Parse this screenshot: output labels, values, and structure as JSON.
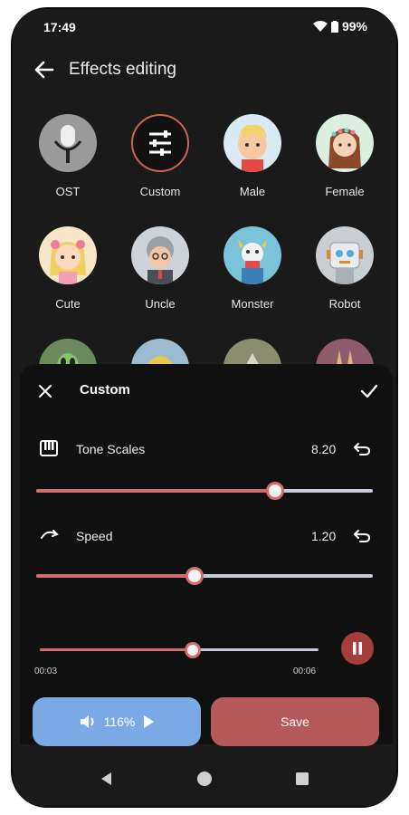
{
  "status": {
    "time": "17:49",
    "battery": "99%"
  },
  "header": {
    "title": "Effects editing"
  },
  "effects": [
    {
      "label": "OST",
      "icon": "microphone-icon"
    },
    {
      "label": "Custom",
      "icon": "sliders-icon",
      "selected": true
    },
    {
      "label": "Male",
      "icon": "male-avatar-icon"
    },
    {
      "label": "Female",
      "icon": "female-avatar-icon"
    },
    {
      "label": "Cute",
      "icon": "cute-avatar-icon"
    },
    {
      "label": "Uncle",
      "icon": "uncle-avatar-icon"
    },
    {
      "label": "Monster",
      "icon": "monster-avatar-icon"
    },
    {
      "label": "Robot",
      "icon": "robot-avatar-icon"
    }
  ],
  "sheet": {
    "title": "Custom",
    "tone": {
      "label": "Tone Scales",
      "value": "8.20",
      "level": 0.71
    },
    "speed": {
      "label": "Speed",
      "value": "1.20",
      "level": 0.47
    },
    "playback": {
      "current": "00:03",
      "total": "00:06",
      "level": 0.55
    }
  },
  "buttons": {
    "volume": "116%",
    "save": "Save"
  },
  "colors": {
    "accent": "#d26d6d",
    "play_button": "#7aa9e6",
    "save_button": "#b55a5a",
    "background": "#1a1a1a"
  }
}
